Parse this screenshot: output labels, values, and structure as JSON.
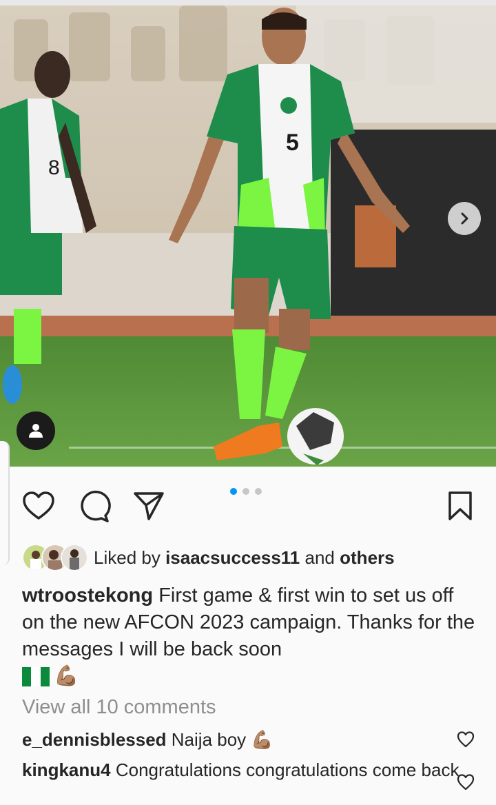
{
  "post": {
    "image": {
      "description_icons": [
        "chevron-right-icon",
        "user-tag-icon"
      ],
      "carousel": {
        "total": 3,
        "active_index": 0
      }
    },
    "actions": {
      "icons": [
        "heart-icon",
        "comment-icon",
        "share-icon",
        "bookmark-icon"
      ]
    },
    "likes": {
      "prefix": "Liked by",
      "user": "isaacsuccess11",
      "and": "and",
      "others": "others"
    },
    "caption": {
      "username": "wtroostekong",
      "text": "First game & first win to set us off on the new AFCON 2023 campaign. Thanks for the messages I will be back soon",
      "emoji": "💪🏽"
    },
    "view_all_comments": "View all 10 comments",
    "comments": [
      {
        "username": "e_dennisblessed",
        "text": "Naija boy 💪🏽"
      },
      {
        "username": "kingkanu4",
        "text": "Congratulations congratulations come back"
      }
    ]
  },
  "colors": {
    "accent": "#0095f6",
    "text": "#262626",
    "muted": "#8e8e8e",
    "jersey_green": "#1e8c4a",
    "jersey_lime": "#7cf542"
  }
}
